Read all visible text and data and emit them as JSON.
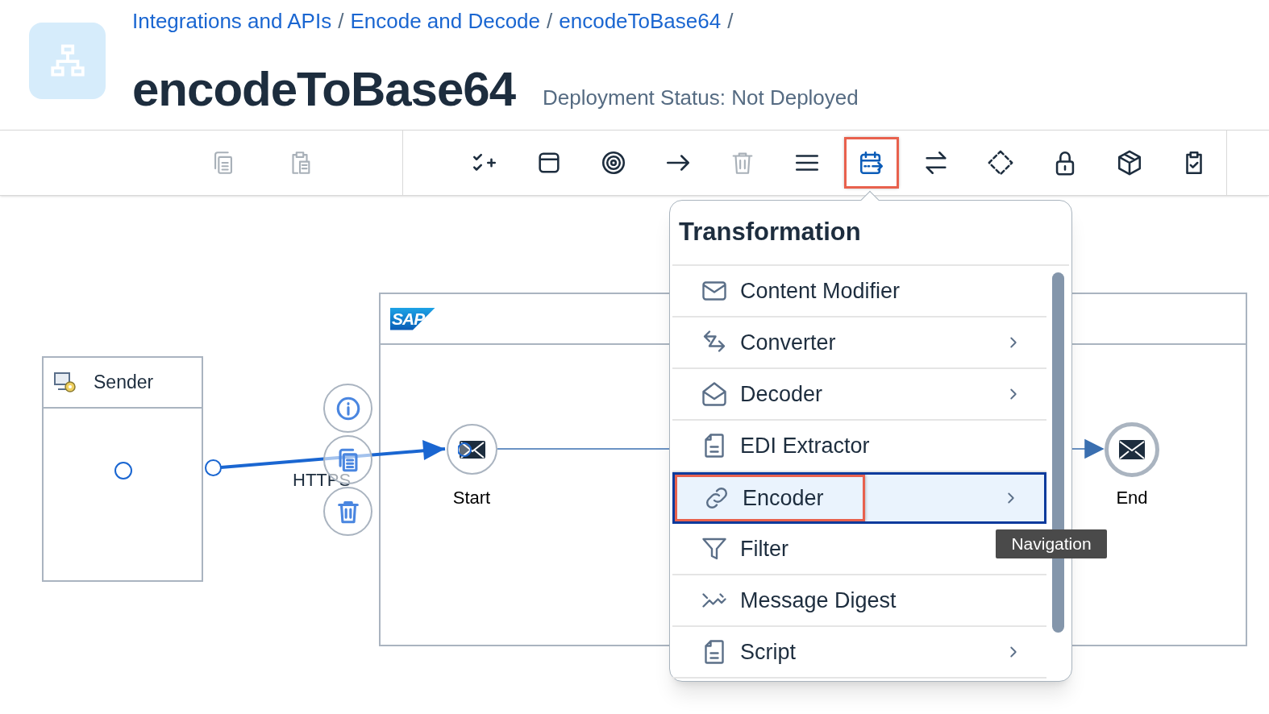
{
  "breadcrumb": {
    "separator": "/",
    "items": [
      {
        "label": "Integrations and APIs"
      },
      {
        "label": "Encode and Decode"
      },
      {
        "label": "encodeToBase64"
      }
    ]
  },
  "title": "encodeToBase64",
  "deployment_status": "Deployment Status: Not Deployed",
  "toolbar": {
    "left_tools": [
      {
        "kind": "copy",
        "disabled": true
      },
      {
        "kind": "paste",
        "disabled": true
      }
    ],
    "tools": [
      {
        "kind": "check-add",
        "disabled": false,
        "selected": false,
        "highlighted": false
      },
      {
        "kind": "window",
        "disabled": false,
        "selected": false,
        "highlighted": false
      },
      {
        "kind": "target",
        "disabled": false,
        "selected": false,
        "highlighted": false
      },
      {
        "kind": "arrow",
        "disabled": false,
        "selected": false,
        "highlighted": false
      },
      {
        "kind": "delete",
        "disabled": true,
        "selected": false,
        "highlighted": false
      },
      {
        "kind": "menu",
        "disabled": false,
        "selected": false,
        "highlighted": false
      },
      {
        "kind": "transform",
        "disabled": false,
        "selected": true,
        "highlighted": true
      },
      {
        "kind": "swap",
        "disabled": false,
        "selected": false,
        "highlighted": false
      },
      {
        "kind": "diamond",
        "disabled": false,
        "selected": false,
        "highlighted": false
      },
      {
        "kind": "lock",
        "disabled": false,
        "selected": false,
        "highlighted": false
      },
      {
        "kind": "cube",
        "disabled": false,
        "selected": false,
        "highlighted": false
      },
      {
        "kind": "clipboard-check",
        "disabled": false,
        "selected": false,
        "highlighted": false
      }
    ]
  },
  "menu": {
    "title": "Transformation",
    "items": [
      {
        "label": "Content Modifier",
        "kind": "envelope",
        "submenu": false,
        "selected": false,
        "highlighted": false
      },
      {
        "label": "Converter",
        "kind": "converter",
        "submenu": true,
        "selected": false,
        "highlighted": false
      },
      {
        "label": "Decoder",
        "kind": "open-envelope",
        "submenu": true,
        "selected": false,
        "highlighted": false
      },
      {
        "label": "EDI Extractor",
        "kind": "document",
        "submenu": false,
        "selected": false,
        "highlighted": false
      },
      {
        "label": "Encoder",
        "kind": "link",
        "submenu": true,
        "selected": true,
        "highlighted": true
      },
      {
        "label": "Filter",
        "kind": "filter",
        "submenu": false,
        "selected": false,
        "highlighted": false
      },
      {
        "label": "Message Digest",
        "kind": "digest",
        "submenu": false,
        "selected": false,
        "highlighted": false
      },
      {
        "label": "Script",
        "kind": "document",
        "submenu": true,
        "selected": false,
        "highlighted": false
      }
    ]
  },
  "tooltip": "Navigation",
  "diagram": {
    "sender": {
      "label": "Sender"
    },
    "process": {
      "logo": "SAP"
    },
    "connection": {
      "label": "HTTPS"
    },
    "start": {
      "label": "Start"
    },
    "end": {
      "label": "End"
    },
    "connection_actions": [
      {
        "kind": "info"
      },
      {
        "kind": "copy"
      },
      {
        "kind": "delete"
      }
    ]
  }
}
